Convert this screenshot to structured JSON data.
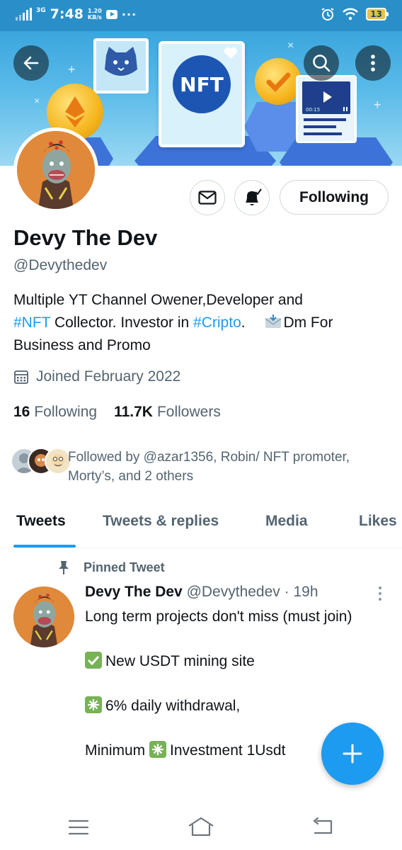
{
  "status_bar": {
    "network": "3G",
    "time": "7:48",
    "speed_value": "1.20",
    "speed_unit": "KB/s",
    "battery": "13",
    "more": "···"
  },
  "banner": {
    "nft_label": "NFT",
    "video_time": "00:15"
  },
  "header_buttons": {
    "back_icon": "arrow-left-icon",
    "search_icon": "search-icon",
    "more_icon": "more-vertical-icon"
  },
  "profile": {
    "name": "Devy The Dev",
    "handle": "@Devythedev",
    "bio": {
      "line1": "Multiple YT Channel Owener,Developer and",
      "tag_nft": "#NFT",
      "text_collector": " Collector. Investor in ",
      "tag_cripto": "#Cripto",
      "text_period": ".",
      "text_dm": "Dm For",
      "line3": "Business and Promo"
    },
    "joined": "Joined February 2022",
    "following_count": "16",
    "following_label": "Following",
    "followers_count": "11.7K",
    "followers_label": "Followers",
    "followed_by": "Followed by @azar1356, Robin/ NFT promoter, Morty’s, and 2 others",
    "following_button": "Following"
  },
  "tabs": [
    {
      "label": "Tweets",
      "active": true
    },
    {
      "label": "Tweets & replies",
      "active": false
    },
    {
      "label": "Media",
      "active": false
    },
    {
      "label": "Likes",
      "active": false
    }
  ],
  "tweet": {
    "pinned_label": "Pinned Tweet",
    "author_name": "Devy The Dev",
    "author_handle": "@Devythedev",
    "time": "· 19h",
    "line1": "Long term projects don't miss (must join)",
    "line2": "New USDT mining site",
    "line3": "6% daily withdrawal,",
    "line4_a": "Minimum",
    "line4_b": "Investment 1Usdt"
  },
  "colors": {
    "accent": "#1d9bf0",
    "status_bar": "#2a8fc9",
    "secondary_text": "#536471"
  }
}
